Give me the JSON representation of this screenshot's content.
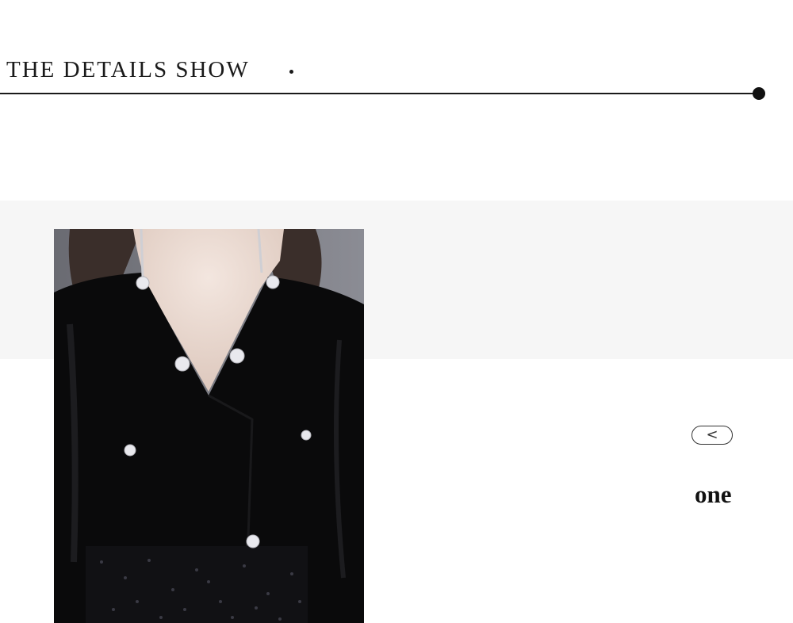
{
  "header": {
    "title": "THE DETAILS SHOW"
  },
  "gallery": {
    "prev_glyph": "<",
    "caption": "one",
    "image_alt": "Close-up of black velvet V-neck dress with crystal floral buttons and sequin skirt"
  },
  "colors": {
    "accent": "#111111",
    "band": "#f6f6f6",
    "velvet": "#0a0a0b"
  }
}
